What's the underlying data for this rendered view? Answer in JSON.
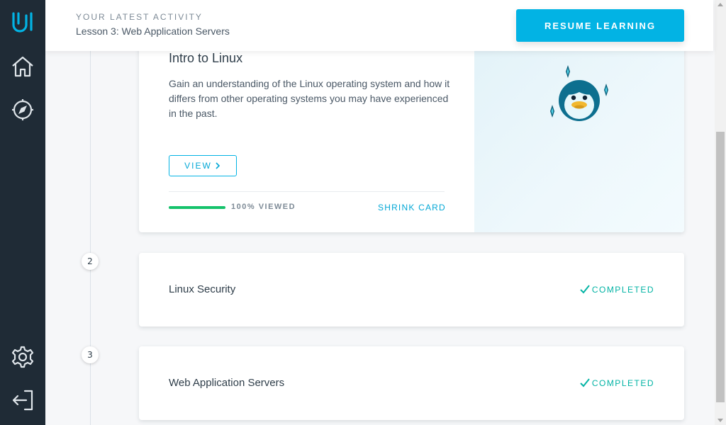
{
  "header": {
    "activity_label": "YOUR LATEST ACTIVITY",
    "activity_lesson": "Lesson 3: Web Application Servers",
    "resume_label": "RESUME LEARNING"
  },
  "sidebar": {
    "items": [
      {
        "name": "logo",
        "icon": "udacity-logo-icon"
      },
      {
        "name": "home",
        "icon": "home-icon"
      },
      {
        "name": "explore",
        "icon": "compass-icon"
      },
      {
        "name": "settings",
        "icon": "gear-icon"
      },
      {
        "name": "logout",
        "icon": "logout-icon"
      }
    ]
  },
  "lessons": {
    "current": {
      "title": "Intro to Linux",
      "description": "Gain an understanding of the Linux operating system and how it differs from other operating systems you may have experienced in the past.",
      "view_label": "VIEW",
      "progress_percent": 100,
      "progress_text": "100% VIEWED",
      "shrink_label": "SHRINK CARD",
      "image_icon": "penguin-icon"
    },
    "items": [
      {
        "number": "2",
        "title": "Linux Security",
        "status": "COMPLETED"
      },
      {
        "number": "3",
        "title": "Web Application Servers",
        "status": "COMPLETED"
      }
    ]
  },
  "colors": {
    "sidebar": "#1f2b36",
    "accent": "#02b3e4",
    "progress": "#15c26b",
    "completed": "#02b3a4"
  }
}
